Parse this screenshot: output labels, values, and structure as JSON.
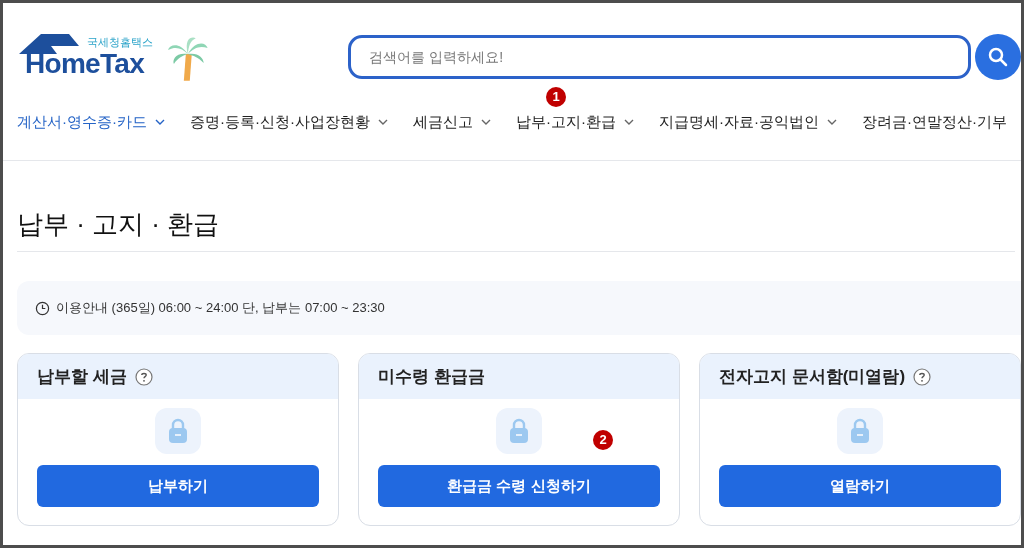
{
  "logo": {
    "subtitle": "국세청홈택스",
    "title": "HomeTax"
  },
  "search": {
    "placeholder": "검색어를 입력하세요!"
  },
  "nav": [
    {
      "label": "계산서·영수증·카드",
      "selected": true
    },
    {
      "label": "증명·등록·신청·사업장현황",
      "selected": false
    },
    {
      "label": "세금신고",
      "selected": false
    },
    {
      "label": "납부·고지·환급",
      "selected": false,
      "marker": "1"
    },
    {
      "label": "지급명세·자료·공익법인",
      "selected": false
    },
    {
      "label": "장려금·연말정산·기부",
      "selected": false
    }
  ],
  "page_title": "납부 · 고지 · 환급",
  "notice": "이용안내 (365일) 06:00 ~ 24:00 단, 납부는 07:00 ~ 23:30",
  "cards": [
    {
      "title": "납부할 세금",
      "help": true,
      "button": "납부하기"
    },
    {
      "title": "미수령 환급금",
      "help": false,
      "button": "환급금 수령 신청하기",
      "marker": "2"
    },
    {
      "title": "전자고지 문서함(미열람)",
      "help": true,
      "button": "열람하기"
    }
  ]
}
